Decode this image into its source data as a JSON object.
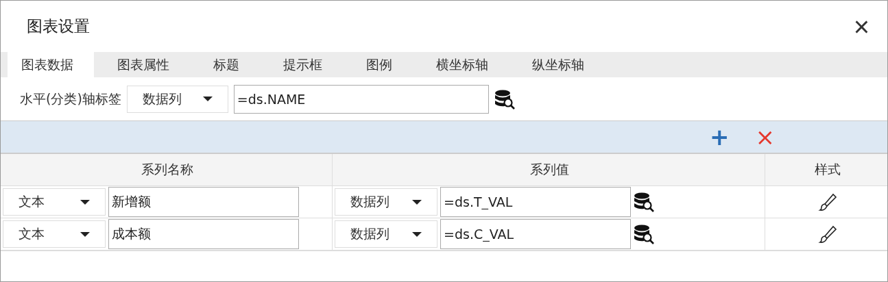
{
  "window": {
    "title": "图表设置",
    "close": "×"
  },
  "tabs": [
    {
      "label": "图表数据",
      "selected": true
    },
    {
      "label": "图表属性",
      "selected": false
    },
    {
      "label": "标题",
      "selected": false
    },
    {
      "label": "提示框",
      "selected": false
    },
    {
      "label": "图例",
      "selected": false
    },
    {
      "label": "横坐标轴",
      "selected": false
    },
    {
      "label": "纵坐标轴",
      "selected": false
    }
  ],
  "axis": {
    "label": "水平(分类)轴标签",
    "type": "数据列",
    "value": "=ds.NAME"
  },
  "toolbar": {
    "add": "+",
    "remove": "×"
  },
  "table": {
    "columns": [
      "系列名称",
      "系列值",
      "样式"
    ],
    "rows": [
      {
        "name_type": "文本",
        "name": "新增额",
        "value_type": "数据列",
        "value": "=ds.T_VAL"
      },
      {
        "name_type": "文本",
        "name": "成本额",
        "value_type": "数据列",
        "value": "=ds.C_VAL"
      }
    ]
  }
}
